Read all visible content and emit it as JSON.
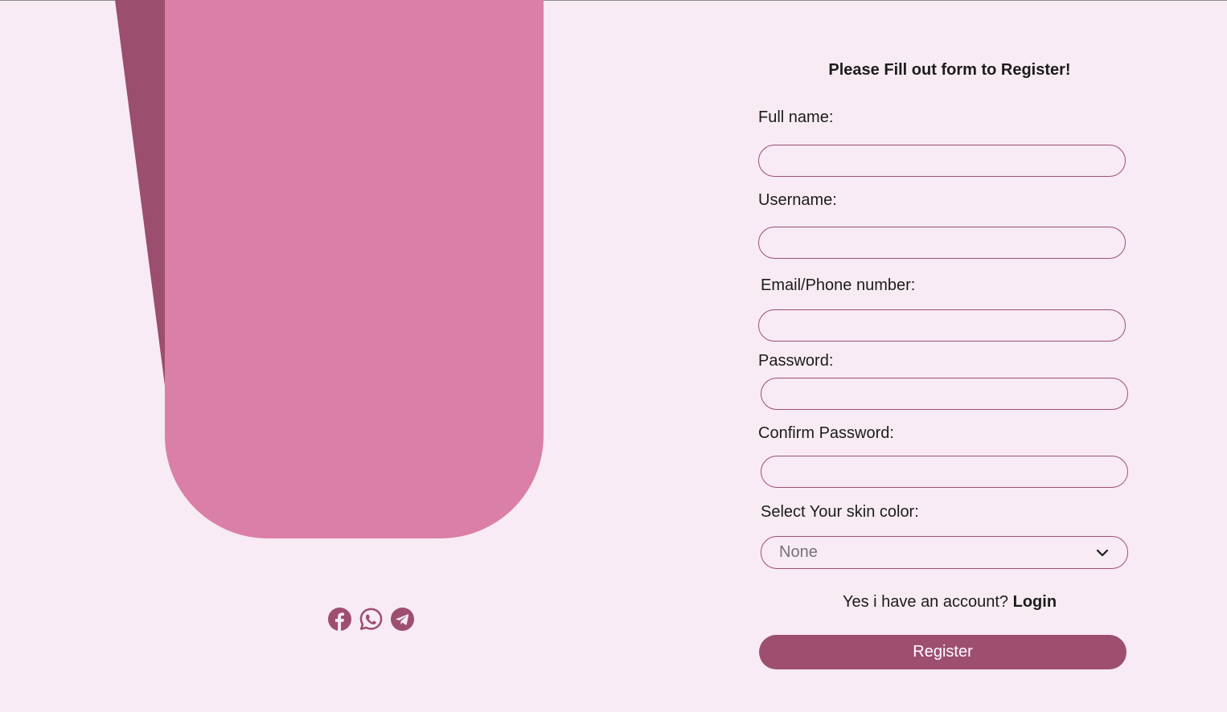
{
  "colors": {
    "background": "#f8ebf3",
    "panel": "#da7fa7",
    "panel_shadow": "#9b4e6d",
    "accent": "#9e4f70"
  },
  "socials": [
    {
      "icon": "facebook-icon"
    },
    {
      "icon": "whatsapp-icon"
    },
    {
      "icon": "telegram-icon"
    }
  ],
  "form": {
    "title": "Please Fill out form to Register!",
    "full_name_label": "Full name:",
    "full_name_value": "",
    "username_label": "Username:",
    "username_value": "",
    "contact_label": "Email/Phone number:",
    "contact_value": "",
    "password_label": "Password:",
    "password_value": "",
    "confirm_password_label": "Confirm Password:",
    "confirm_password_value": "",
    "skin_color_label": "Select Your skin color:",
    "skin_color_selected": "None",
    "login_prompt": "Yes i have an account?",
    "login_link": "Login",
    "register_label": "Register"
  }
}
